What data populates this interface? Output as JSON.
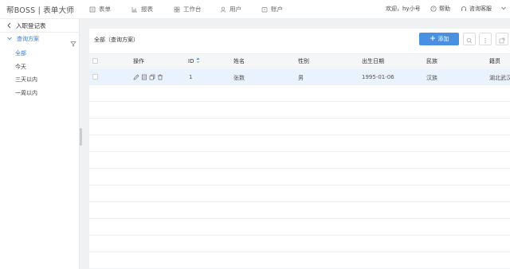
{
  "app": {
    "brand": "帮BOSS | 表单大师"
  },
  "nav": [
    {
      "label": "表单",
      "icon": "form-icon"
    },
    {
      "label": "报表",
      "icon": "chart-icon"
    },
    {
      "label": "工作台",
      "icon": "grid-icon"
    },
    {
      "label": "用户",
      "icon": "user-icon"
    },
    {
      "label": "账户",
      "icon": "account-icon"
    }
  ],
  "header": {
    "welcome": "欢迎，hy小号",
    "help": "帮助",
    "support": "咨询客服"
  },
  "sidebar": {
    "back_label": "入职登记表",
    "group_label": "查询方案",
    "items": [
      {
        "label": "全部",
        "active": true
      },
      {
        "label": "今天"
      },
      {
        "label": "三天以内"
      },
      {
        "label": "一周以内"
      }
    ]
  },
  "toolbar": {
    "scope_label": "全部（查询方案）",
    "add_label": "添加"
  },
  "table": {
    "columns": [
      "操作",
      "ID",
      "姓名",
      "性别",
      "出生日期",
      "民族",
      "籍贯"
    ],
    "rows": [
      {
        "id": "1",
        "name": "张数",
        "gender": "男",
        "birth": "1995-01-06",
        "ethnic": "汉族",
        "origin": "湖北武汉"
      }
    ]
  },
  "colors": {
    "accent": "#4a90e2",
    "selected_row": "#eaf2fd"
  }
}
